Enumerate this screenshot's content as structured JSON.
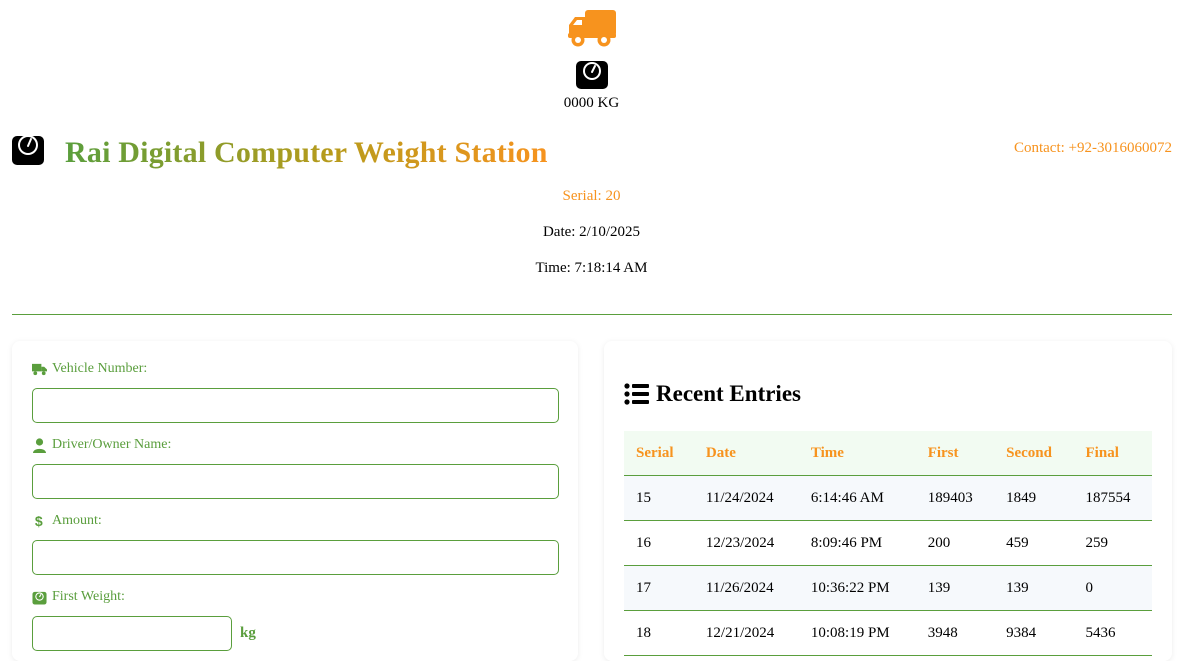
{
  "header": {
    "truck_icon": "truck-icon",
    "scale_icon": "scale-icon",
    "weight_readout": "0000 KG"
  },
  "brand": {
    "title": "Rai Digital Computer Weight Station",
    "icon": "scale-icon",
    "gradient_colors": [
      "#5a9e3d",
      "#f7931e"
    ]
  },
  "contact": "Contact: +92-3016060072",
  "meta": {
    "serial": "Serial: 20",
    "date": "Date: 2/10/2025",
    "time": "Time: 7:18:14 AM"
  },
  "form": {
    "vehicle_label": "Vehicle Number:",
    "vehicle_value": "",
    "driver_label": "Driver/Owner Name:",
    "driver_value": "",
    "amount_label": "Amount:",
    "amount_value": "",
    "first_weight_label": "First Weight:",
    "first_weight_value": "",
    "first_weight_unit": "kg"
  },
  "recent": {
    "title": "Recent Entries",
    "icon": "list-icon",
    "columns": [
      "Serial",
      "Date",
      "Time",
      "First",
      "Second",
      "Final"
    ],
    "rows": [
      [
        "15",
        "11/24/2024",
        "6:14:46 AM",
        "189403",
        "1849",
        "187554"
      ],
      [
        "16",
        "12/23/2024",
        "8:09:46 PM",
        "200",
        "459",
        "259"
      ],
      [
        "17",
        "11/26/2024",
        "10:36:22 PM",
        "139",
        "139",
        "0"
      ],
      [
        "18",
        "12/21/2024",
        "10:08:19 PM",
        "3948",
        "9384",
        "5436"
      ]
    ]
  },
  "colors": {
    "accent_green": "#5a9e3d",
    "accent_orange": "#f7931e",
    "table_header_bg": "#f2fbf2"
  }
}
